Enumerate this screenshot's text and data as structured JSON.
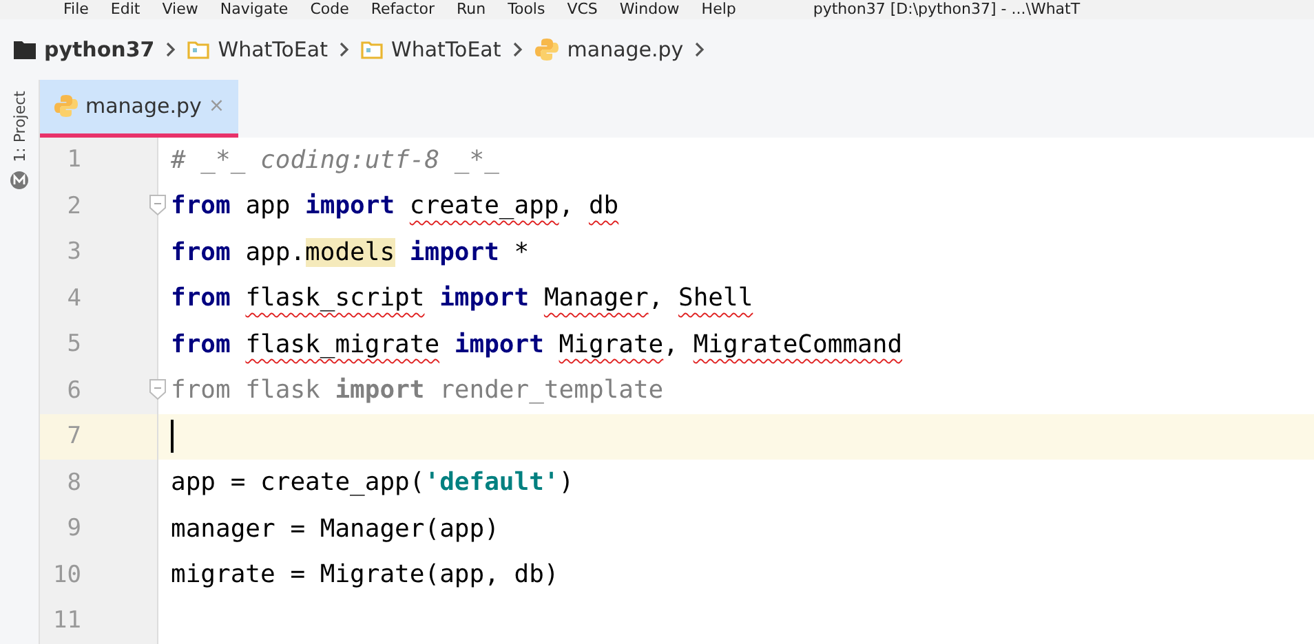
{
  "menu_bar": {
    "items": [
      "File",
      "Edit",
      "View",
      "Navigate",
      "Code",
      "Refactor",
      "Run",
      "Tools",
      "VCS",
      "Window",
      "Help"
    ],
    "title": "python37 [D:\\python37] - ...\\WhatT"
  },
  "breadcrumb": [
    {
      "label": "python37",
      "kind": "root"
    },
    {
      "label": "WhatToEat",
      "kind": "folder"
    },
    {
      "label": "WhatToEat",
      "kind": "folder"
    },
    {
      "label": "manage.py",
      "kind": "python"
    }
  ],
  "side_tool": {
    "label": "1: Project"
  },
  "tabs": [
    {
      "label": "manage.py",
      "close": "×",
      "selected": true
    }
  ],
  "editor": {
    "lines": [
      {
        "number": "1",
        "current": false,
        "fold": false,
        "tokens": [
          {
            "text": "# _*_ coding:utf-8 _*_",
            "kind": "comment"
          }
        ]
      },
      {
        "number": "2",
        "current": false,
        "fold": true,
        "tokens": [
          {
            "text": "from ",
            "kind": "keyword"
          },
          {
            "text": "app ",
            "kind": "plain"
          },
          {
            "text": "import ",
            "kind": "keyword"
          },
          {
            "text": "create_app",
            "kind": "squiggle"
          },
          {
            "text": ", ",
            "kind": "plain"
          },
          {
            "text": "db",
            "kind": "squiggle"
          }
        ]
      },
      {
        "number": "3",
        "current": false,
        "fold": false,
        "tokens": [
          {
            "text": "from ",
            "kind": "keyword"
          },
          {
            "text": "app.",
            "kind": "plain"
          },
          {
            "text": "models",
            "kind": "highlight"
          },
          {
            "text": " import",
            "kind": "keyword"
          },
          {
            "text": " *",
            "kind": "plain"
          }
        ]
      },
      {
        "number": "4",
        "current": false,
        "fold": false,
        "tokens": [
          {
            "text": "from ",
            "kind": "keyword"
          },
          {
            "text": "flask_script",
            "kind": "squiggle"
          },
          {
            "text": " import ",
            "kind": "keyword"
          },
          {
            "text": "Manager",
            "kind": "squiggle"
          },
          {
            "text": ", ",
            "kind": "plain"
          },
          {
            "text": "Shell",
            "kind": "squiggle"
          }
        ]
      },
      {
        "number": "5",
        "current": false,
        "fold": false,
        "tokens": [
          {
            "text": "from ",
            "kind": "keyword"
          },
          {
            "text": "flask_migrate",
            "kind": "squiggle"
          },
          {
            "text": " import ",
            "kind": "keyword"
          },
          {
            "text": "Migrate",
            "kind": "squiggle"
          },
          {
            "text": ", ",
            "kind": "plain"
          },
          {
            "text": "MigrateCommand",
            "kind": "squiggle"
          }
        ]
      },
      {
        "number": "6",
        "current": false,
        "fold": true,
        "tokens": [
          {
            "text": "from flask ",
            "kind": "unused"
          },
          {
            "text": "import",
            "kind": "unused-keyword"
          },
          {
            "text": " render_template",
            "kind": "unused"
          }
        ]
      },
      {
        "number": "7",
        "current": true,
        "fold": false
      },
      {
        "number": "8",
        "current": false,
        "fold": false,
        "tokens": [
          {
            "text": "app = create_app(",
            "kind": "plain"
          },
          {
            "text": "'default'",
            "kind": "string"
          },
          {
            "text": ")",
            "kind": "plain"
          }
        ]
      },
      {
        "number": "9",
        "current": false,
        "fold": false,
        "tokens": [
          {
            "text": "manager = Manager(app)",
            "kind": "plain"
          }
        ]
      },
      {
        "number": "10",
        "current": false,
        "fold": false,
        "tokens": [
          {
            "text": "migrate = Migrate(app, db)",
            "kind": "plain"
          }
        ]
      },
      {
        "number": "11",
        "current": false,
        "fold": false
      }
    ]
  }
}
